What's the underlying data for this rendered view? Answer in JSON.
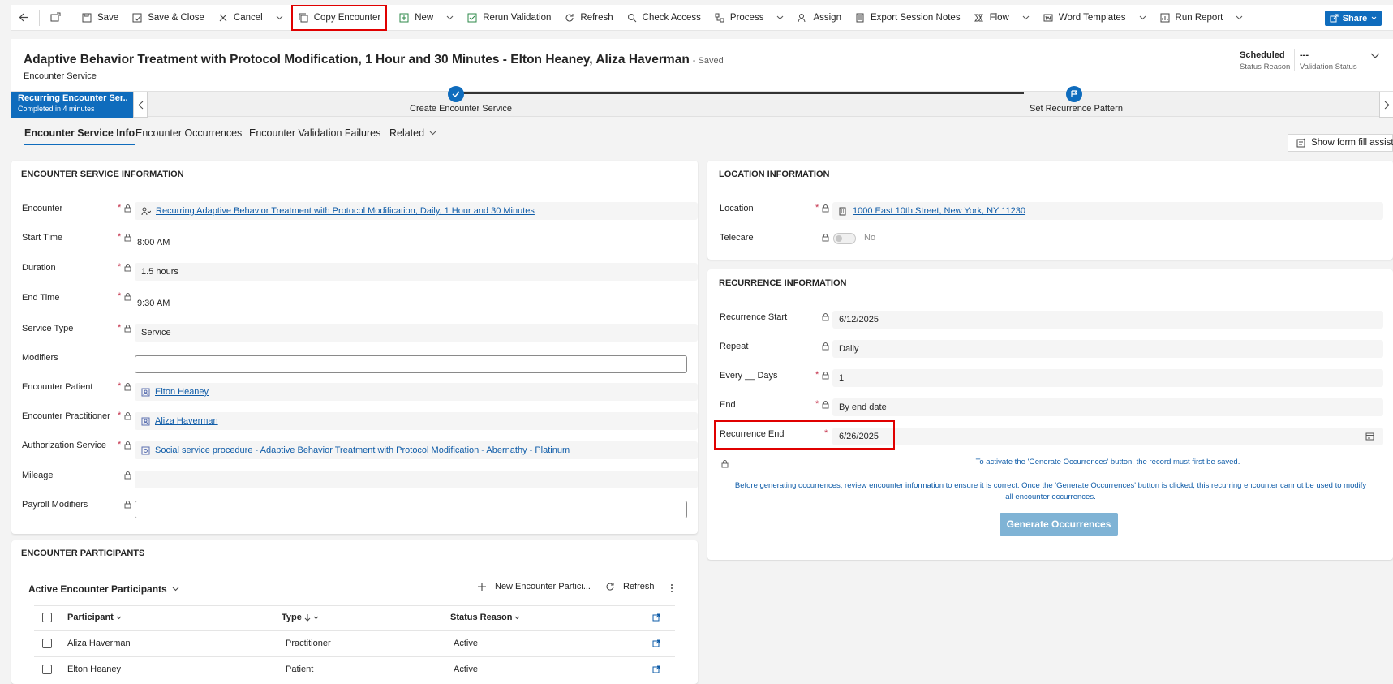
{
  "commandbar": {
    "save": "Save",
    "save_close": "Save & Close",
    "cancel": "Cancel",
    "copy_encounter": "Copy Encounter",
    "new": "New",
    "rerun_validation": "Rerun Validation",
    "refresh": "Refresh",
    "check_access": "Check Access",
    "process": "Process",
    "assign": "Assign",
    "export_session_notes": "Export Session Notes",
    "flow": "Flow",
    "word_templates": "Word Templates",
    "run_report": "Run Report",
    "share": "Share"
  },
  "header": {
    "title": "Adaptive Behavior Treatment with Protocol Modification, 1 Hour and 30 Minutes - Elton Heaney, Aliza Haverman",
    "saved": "- Saved",
    "entity": "Encounter Service",
    "status_reason_value": "Scheduled",
    "status_reason_label": "Status Reason",
    "validation_status_value": "---",
    "validation_status_label": "Validation Status"
  },
  "bpf": {
    "active_title": "Recurring Encounter Ser...",
    "active_sub": "Completed in 4 minutes",
    "stage1": "Create Encounter Service",
    "stage2": "Set Recurrence Pattern"
  },
  "tabs": {
    "info": "Encounter Service Info",
    "occurrences": "Encounter Occurrences",
    "validation": "Encounter Validation Failures",
    "related": "Related",
    "form_fill": "Show form fill assist"
  },
  "service_info": {
    "title": "ENCOUNTER SERVICE INFORMATION",
    "encounter_label": "Encounter",
    "encounter_value": "Recurring Adaptive Behavior Treatment with Protocol Modification, Daily, 1 Hour and 30 Minutes",
    "start_label": "Start Time",
    "start_value": "8:00 AM",
    "duration_label": "Duration",
    "duration_value": "1.5 hours",
    "end_label": "End Time",
    "end_value": "9:30 AM",
    "service_type_label": "Service Type",
    "service_type_value": "Service",
    "modifiers_label": "Modifiers",
    "patient_label": "Encounter Patient",
    "patient_value": "Elton Heaney",
    "practitioner_label": "Encounter Practitioner",
    "practitioner_value": "Aliza Haverman",
    "auth_label": "Authorization Service",
    "auth_value": "Social service procedure - Adaptive Behavior Treatment with Protocol Modification - Abernathy - Platinum",
    "mileage_label": "Mileage",
    "payroll_label": "Payroll Modifiers"
  },
  "location": {
    "title": "LOCATION INFORMATION",
    "location_label": "Location",
    "location_value": "1000 East 10th Street, New York, NY 11230",
    "telecare_label": "Telecare",
    "telecare_value": "No"
  },
  "recurrence": {
    "title": "RECURRENCE INFORMATION",
    "start_label": "Recurrence Start",
    "start_value": "6/12/2025",
    "repeat_label": "Repeat",
    "repeat_value": "Daily",
    "every_label": "Every __ Days",
    "every_value": "1",
    "end_label": "End",
    "end_value": "By end date",
    "rec_end_label": "Recurrence End",
    "rec_end_value": "6/26/2025",
    "note1": "To activate the 'Generate Occurrences' button, the record must first be saved.",
    "note2": "Before generating occurrences, review encounter information to ensure it is correct. Once the 'Generate Occurrences' button is clicked, this recurring encounter cannot be used to modify all encounter occurrences.",
    "generate": "Generate Occurrences"
  },
  "participants": {
    "title": "ENCOUNTER PARTICIPANTS",
    "view": "Active Encounter Participants",
    "new": "New Encounter Partici...",
    "refresh": "Refresh",
    "col_participant": "Participant",
    "col_type": "Type",
    "col_status": "Status Reason",
    "rows": [
      {
        "participant": "Aliza Haverman",
        "type": "Practitioner",
        "status": "Active"
      },
      {
        "participant": "Elton Heaney",
        "type": "Patient",
        "status": "Active"
      }
    ]
  }
}
